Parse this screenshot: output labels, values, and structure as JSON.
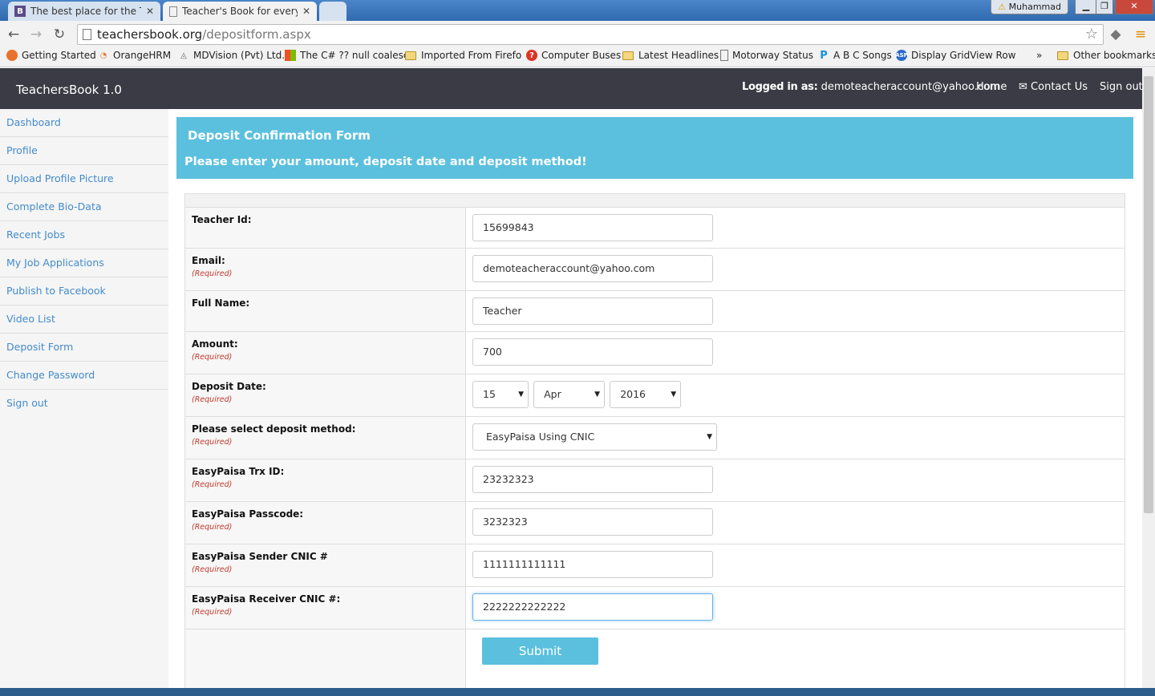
{
  "browser": {
    "tabs": [
      {
        "favicon": "B",
        "title": "The best place for the Tea",
        "active": false
      },
      {
        "favicon": "page-icon",
        "title": "Teacher's Book for every t",
        "active": true
      }
    ],
    "window_user": "Muhammad",
    "url_host": "teachersbook.org",
    "url_path": "/depositform.aspx",
    "bookmarks": [
      "Getting Started",
      "OrangeHRM",
      "MDVision (Pvt) Ltd.",
      "The C# ?? null coalesc",
      "Imported From Firefo",
      "Computer Buses",
      "Latest Headlines",
      "Motorway Status",
      "A B C Songs",
      "Display GridView Row"
    ],
    "more_bookmarks": "»",
    "other_bookmarks": "Other bookmarks"
  },
  "navbar": {
    "brand": "TeachersBook 1.0",
    "logged_in_label": "Logged in as:",
    "logged_in_email": "demoteacheraccount@yahoo.com",
    "home": "Home",
    "contact": "Contact Us",
    "signout": "Sign out"
  },
  "sidebar": {
    "items": [
      "Dashboard",
      "Profile",
      "Upload Profile Picture",
      "Complete Bio-Data",
      "Recent Jobs",
      "My Job Applications",
      "Publish to Facebook",
      "Video List",
      "Deposit Form",
      "Change Password",
      "Sign out"
    ]
  },
  "form": {
    "heading": "Deposit Confirmation Form",
    "subheading": "Please enter your amount, deposit date and deposit method!",
    "required_text": "(Required)",
    "teacher_id": {
      "label": "Teacher Id:",
      "value": "15699843"
    },
    "email": {
      "label": "Email:",
      "value": "demoteacheraccount@yahoo.com"
    },
    "full_name": {
      "label": "Full Name:",
      "value": "Teacher"
    },
    "amount": {
      "label": "Amount:",
      "value": "700"
    },
    "deposit_date": {
      "label": "Deposit Date:",
      "day": "15",
      "month": "Apr",
      "year": "2016"
    },
    "method": {
      "label": "Please select deposit method:",
      "value": "EasyPaisa Using CNIC"
    },
    "trx_id": {
      "label": "EasyPaisa Trx ID:",
      "value": "23232323"
    },
    "passcode": {
      "label": "EasyPaisa Passcode:",
      "value": "3232323"
    },
    "sender_cnic": {
      "label": "EasyPaisa Sender CNIC #",
      "value": "1111111111111"
    },
    "receiver_cnic": {
      "label": "EasyPaisa Receiver CNIC #:",
      "value": "2222222222222"
    },
    "submit": "Submit"
  },
  "colors": {
    "navbar_bg": "#3b3b45",
    "banner_bg": "#5bc0de",
    "link": "#428bca",
    "required": "#c0392b"
  }
}
